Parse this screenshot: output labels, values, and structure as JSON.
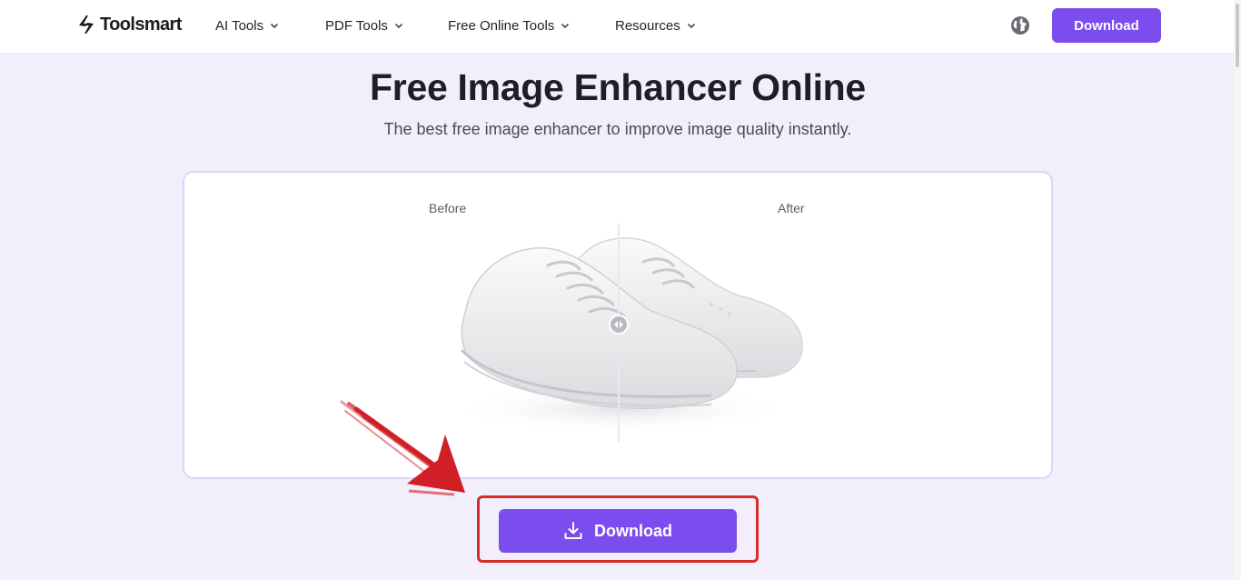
{
  "header": {
    "logo_text": "Toolsmart",
    "nav": [
      {
        "label": "AI Tools"
      },
      {
        "label": "PDF Tools"
      },
      {
        "label": "Free Online Tools"
      },
      {
        "label": "Resources"
      }
    ],
    "language_icon": "globe-icon",
    "download_label": "Download"
  },
  "hero": {
    "title": "Free Image Enhancer Online",
    "subtitle": "The best free image enhancer to improve image quality instantly."
  },
  "compare": {
    "before_label": "Before",
    "after_label": "After",
    "handle_icon": "compare-handle-icon"
  },
  "cta": {
    "label": "Download",
    "icon": "download-icon"
  },
  "colors": {
    "accent": "#7c4dee",
    "page_bg": "#f2eefc",
    "highlight": "#d62b2b"
  }
}
